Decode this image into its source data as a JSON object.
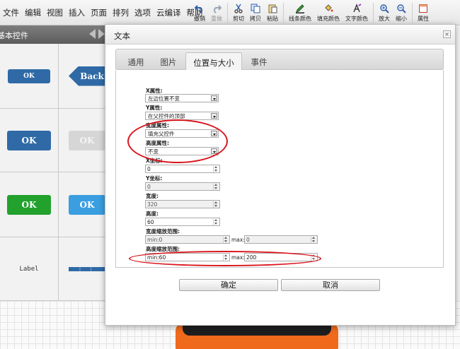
{
  "menu": [
    "文件",
    "编辑",
    "视图",
    "插入",
    "页面",
    "排列",
    "选项",
    "云编译",
    "帮助"
  ],
  "toolbar": {
    "undo": "撤销",
    "redo": "重做",
    "cut": "剪切",
    "copy": "拷贝",
    "paste": "粘贴",
    "line_color": "线条颜色",
    "fill_color": "填充颜色",
    "text_color": "文字颜色",
    "zoom_in": "放大",
    "zoom_out": "缩小",
    "properties": "属性"
  },
  "left_panel": {
    "title": "基本控件",
    "widgets": {
      "ok": "OK",
      "back": "Back",
      "label": "Label"
    }
  },
  "dialog": {
    "title": "文本",
    "close": "×",
    "tabs": [
      "通用",
      "图片",
      "位置与大小",
      "事件"
    ],
    "active_tab": "位置与大小",
    "fields": {
      "x_attr_label": "X属性:",
      "x_attr_value": "左边位置不变",
      "y_attr_label": "Y属性:",
      "y_attr_value": "在父控件的顶部",
      "width_attr_label": "宽度属性:",
      "width_attr_value": "填充父控件",
      "height_attr_label": "高度属性:",
      "height_attr_value": "不变",
      "x_coord_label": "X坐标:",
      "x_coord_value": "0",
      "y_coord_label": "Y坐标:",
      "y_coord_value": "0",
      "width_label": "宽度:",
      "width_value": "320",
      "height_label": "高度:",
      "height_value": "60",
      "width_range_label": "宽度缩放范围:",
      "width_min_label": "min:",
      "width_min_value": "0",
      "width_max_label": "max:",
      "width_max_value": "0",
      "height_range_label": "高度缩放范围:",
      "height_min_label": "min:",
      "height_min_value": "60",
      "height_max_label": "max:",
      "height_max_value": "200"
    },
    "confirm": "确定",
    "cancel": "取消"
  },
  "colors": {
    "annotation": "#d9141b",
    "ok_blue": "#2f6aa6",
    "ok_green": "#22a12d",
    "ok_light_blue": "#3a9ee0",
    "device_orange": "#f06a1c"
  }
}
